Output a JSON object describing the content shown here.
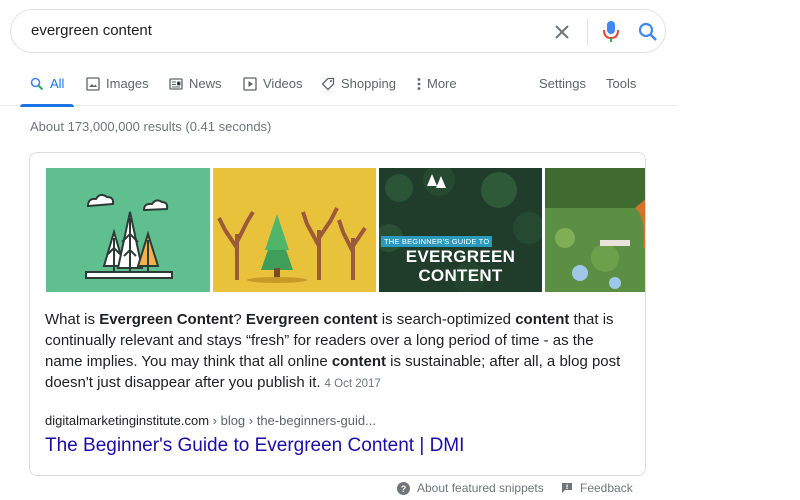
{
  "search": {
    "query": "evergreen content",
    "icons": [
      "close-icon",
      "microphone-icon",
      "search-icon"
    ]
  },
  "tabs": [
    {
      "label": "All",
      "icon": "search-icon",
      "active": true
    },
    {
      "label": "Images",
      "icon": "image-icon"
    },
    {
      "label": "News",
      "icon": "news-icon"
    },
    {
      "label": "Videos",
      "icon": "play-icon"
    },
    {
      "label": "Shopping",
      "icon": "tag-icon"
    },
    {
      "label": "More",
      "icon": "more-vert-icon"
    }
  ],
  "tools": {
    "settings": "Settings",
    "tools": "Tools"
  },
  "stats": "About 173,000,000 results (0.41 seconds)",
  "snippet": {
    "images": {
      "guide_line": "THE BEGINNER'S GUIDE TO",
      "title_line1": "EVERGREEN",
      "title_line2": "CONTENT"
    },
    "text": {
      "p1": "What is ",
      "b1": "Evergreen Content",
      "p2": "? ",
      "b2": "Evergreen content",
      "p3": " is search-optimized ",
      "b3": "content",
      "p4": " that is continually relevant and stays “fresh” for readers over a long period of time - as the name implies. You may think that all online ",
      "b4": "content",
      "p5": " is sustainable; after all, a blog post doesn't just disappear after you publish it.",
      "date": "4 Oct 2017"
    },
    "cite": {
      "domain": "digitalmarketinginstitute.com",
      "path": " › blog › the-beginners-guid..."
    },
    "title": "The Beginner's Guide to Evergreen Content | DMI"
  },
  "footer": {
    "about": "About featured snippets",
    "feedback": "Feedback"
  },
  "colors": {
    "link": "#1a0dab",
    "accent": "#1a73e8",
    "mic_red": "#ea4335"
  }
}
